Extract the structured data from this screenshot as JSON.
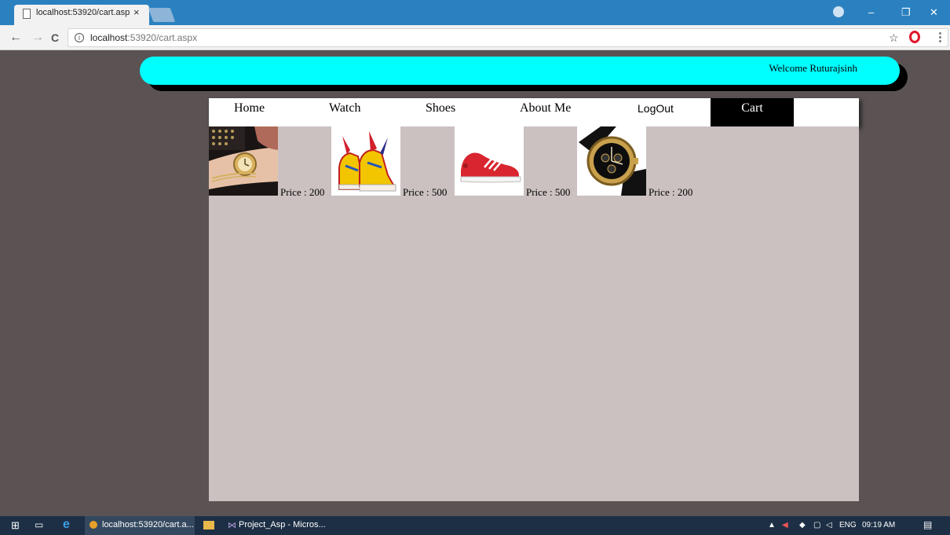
{
  "browser": {
    "tab_title": "localhost:53920/cart.aspx",
    "tab_close": "×",
    "url_host": "localhost",
    "url_rest": ":53920/cart.aspx",
    "info_glyph": "i",
    "back_glyph": "←",
    "forward_glyph": "→",
    "reload_glyph": "C",
    "star_glyph": "☆",
    "menu_glyph": "⋮",
    "minimize_glyph": "–",
    "restore_glyph": "❐",
    "close_glyph": "✕"
  },
  "page": {
    "welcome": "Welcome Ruturajsinh",
    "nav": [
      {
        "label": "Home"
      },
      {
        "label": "Watch"
      },
      {
        "label": "Shoes"
      },
      {
        "label": "About Me"
      },
      {
        "label": "LogOut"
      },
      {
        "label": "Cart"
      }
    ],
    "products": [
      {
        "price": "Price : 200",
        "image": "gold-watch-on-wrist"
      },
      {
        "price": "Price : 500",
        "image": "yellow-red-high-top-sneakers"
      },
      {
        "price": "Price : 500",
        "image": "red-sneaker"
      },
      {
        "price": "Price : 200",
        "image": "black-gold-chronograph-watch"
      }
    ]
  },
  "taskbar": {
    "chrome_item": "localhost:53920/cart.a...",
    "vs_item": "Project_Asp - Micros...",
    "language": "ENG",
    "time": "09:19 AM"
  },
  "colors": {
    "header_bar": "#00ffff",
    "content_bg": "#cbc1c1",
    "page_bg": "#5b5353",
    "cart_active": "#000000"
  }
}
